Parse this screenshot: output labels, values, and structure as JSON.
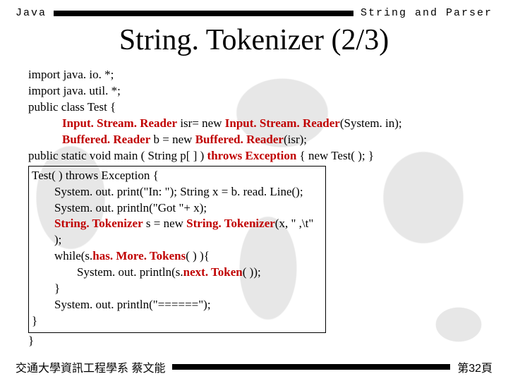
{
  "header": {
    "left": "Java",
    "right": "String and Parser"
  },
  "title": "String. Tokenizer (2/3)",
  "code": {
    "l1": "import java. io. *;",
    "l2": "import java. util. *;",
    "l3": "public class Test {",
    "l4a": "Input. Stream. Reader",
    "l4b": " isr= new ",
    "l4c": "Input. Stream. Reader",
    "l4d": "(System. in);",
    "l5a": "Buffered. Reader",
    "l5b": " b = new ",
    "l5c": "Buffered. Reader",
    "l5d": "(isr);",
    "l6a": "public static void main ( String p[ ] ) ",
    "l6b": "throws",
    "l6c": "Exception",
    "l6d": " {   new Test( );  }",
    "l7": "Test( )  throws Exception  {",
    "l8": "System. out. print(\"In: \");       String x = b. read. Line();",
    "l9": "System. out. println(\"Got \"+ x);",
    "l10a": "String. Tokenizer",
    "l10b": "  s = new ",
    "l10c": "String. Tokenizer",
    "l10d": "(x, \" ,\\t\" );",
    "l11a": "while(s.",
    "l11b": "has. More. Tokens",
    "l11c": "( ) ){",
    "l12a": "System. out. println(s.",
    "l12b": "next. Token",
    "l12c": "( ));",
    "l13": "}",
    "l14": "System. out. println(\"======\");",
    "l15": "}",
    "l16": "}"
  },
  "footer": {
    "left": "交通大學資訊工程學系 蔡文能",
    "right": "第32頁"
  }
}
